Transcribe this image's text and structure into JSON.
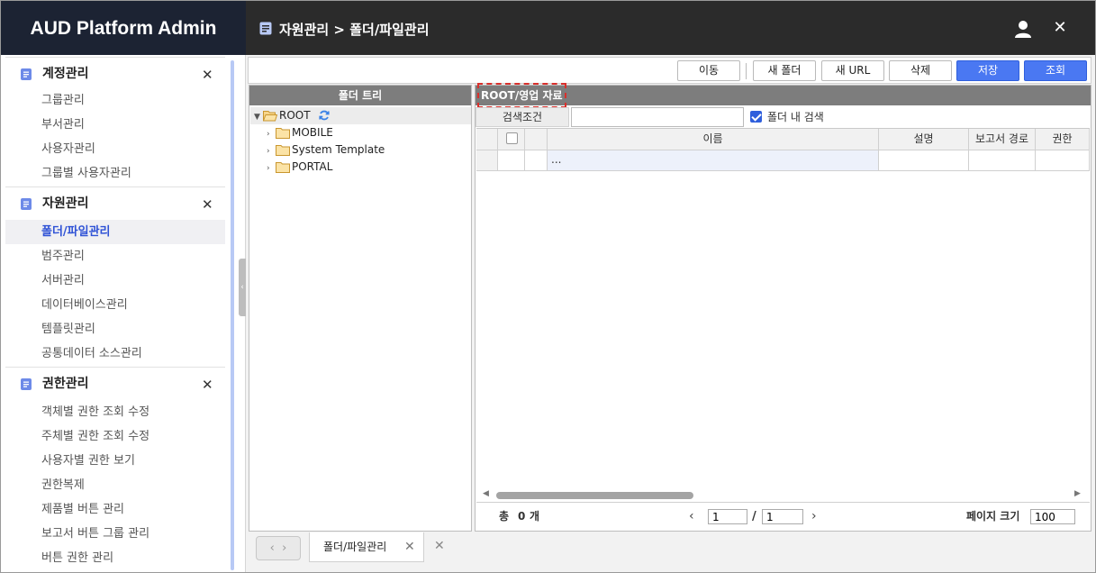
{
  "app": {
    "title": "AUD Platform Admin"
  },
  "header": {
    "breadcrumb": "자원관리 > 폴더/파일관리"
  },
  "sidebar": {
    "sections": [
      {
        "title": "계정관리",
        "items": [
          "그룹관리",
          "부서관리",
          "사용자관리",
          "그룹별 사용자관리"
        ]
      },
      {
        "title": "자원관리",
        "items": [
          "폴더/파일관리",
          "범주관리",
          "서버관리",
          "데이터베이스관리",
          "템플릿관리",
          "공통데이터 소스관리"
        ],
        "active_item": "폴더/파일관리"
      },
      {
        "title": "권한관리",
        "items": [
          "객체별 권한 조회 수정",
          "주체별 권한 조회 수정",
          "사용자별 권한 보기",
          "권한복제",
          "제품별 버튼 관리",
          "보고서 버튼 그룹 관리",
          "버튼 권한 관리"
        ]
      }
    ]
  },
  "toolbar": {
    "move": "이동",
    "new_folder": "새 폴더",
    "new_url": "새 URL",
    "delete": "삭제",
    "save": "저장",
    "search": "조회"
  },
  "tree": {
    "title": "폴더 트리",
    "root": "ROOT",
    "children": [
      "MOBILE",
      "System Template",
      "PORTAL"
    ]
  },
  "content": {
    "path": "ROOT/영업 자료",
    "search_label": "검색조건",
    "search_value": "",
    "search_in_folder_label": "폴더 내 검색",
    "search_in_folder_checked": true,
    "columns": [
      "이름",
      "설명",
      "보고서 경로",
      "권한"
    ],
    "rows": [
      {
        "name": "...",
        "desc": "",
        "path": "",
        "perm": ""
      }
    ]
  },
  "pager": {
    "total_label": "총",
    "total_count": "0",
    "total_unit": "개",
    "current_page": "1",
    "total_pages": "1",
    "page_size_label": "페이지 크기",
    "page_size": "100"
  },
  "tabs": {
    "open": [
      "폴더/파일관리"
    ]
  },
  "colors": {
    "brand_bg": "#1c2333",
    "header_bg": "#2b2b2b",
    "accent": "#4a78f2",
    "active_menu": "#2f52d6",
    "panel_title_bg": "#7d7d7d"
  }
}
